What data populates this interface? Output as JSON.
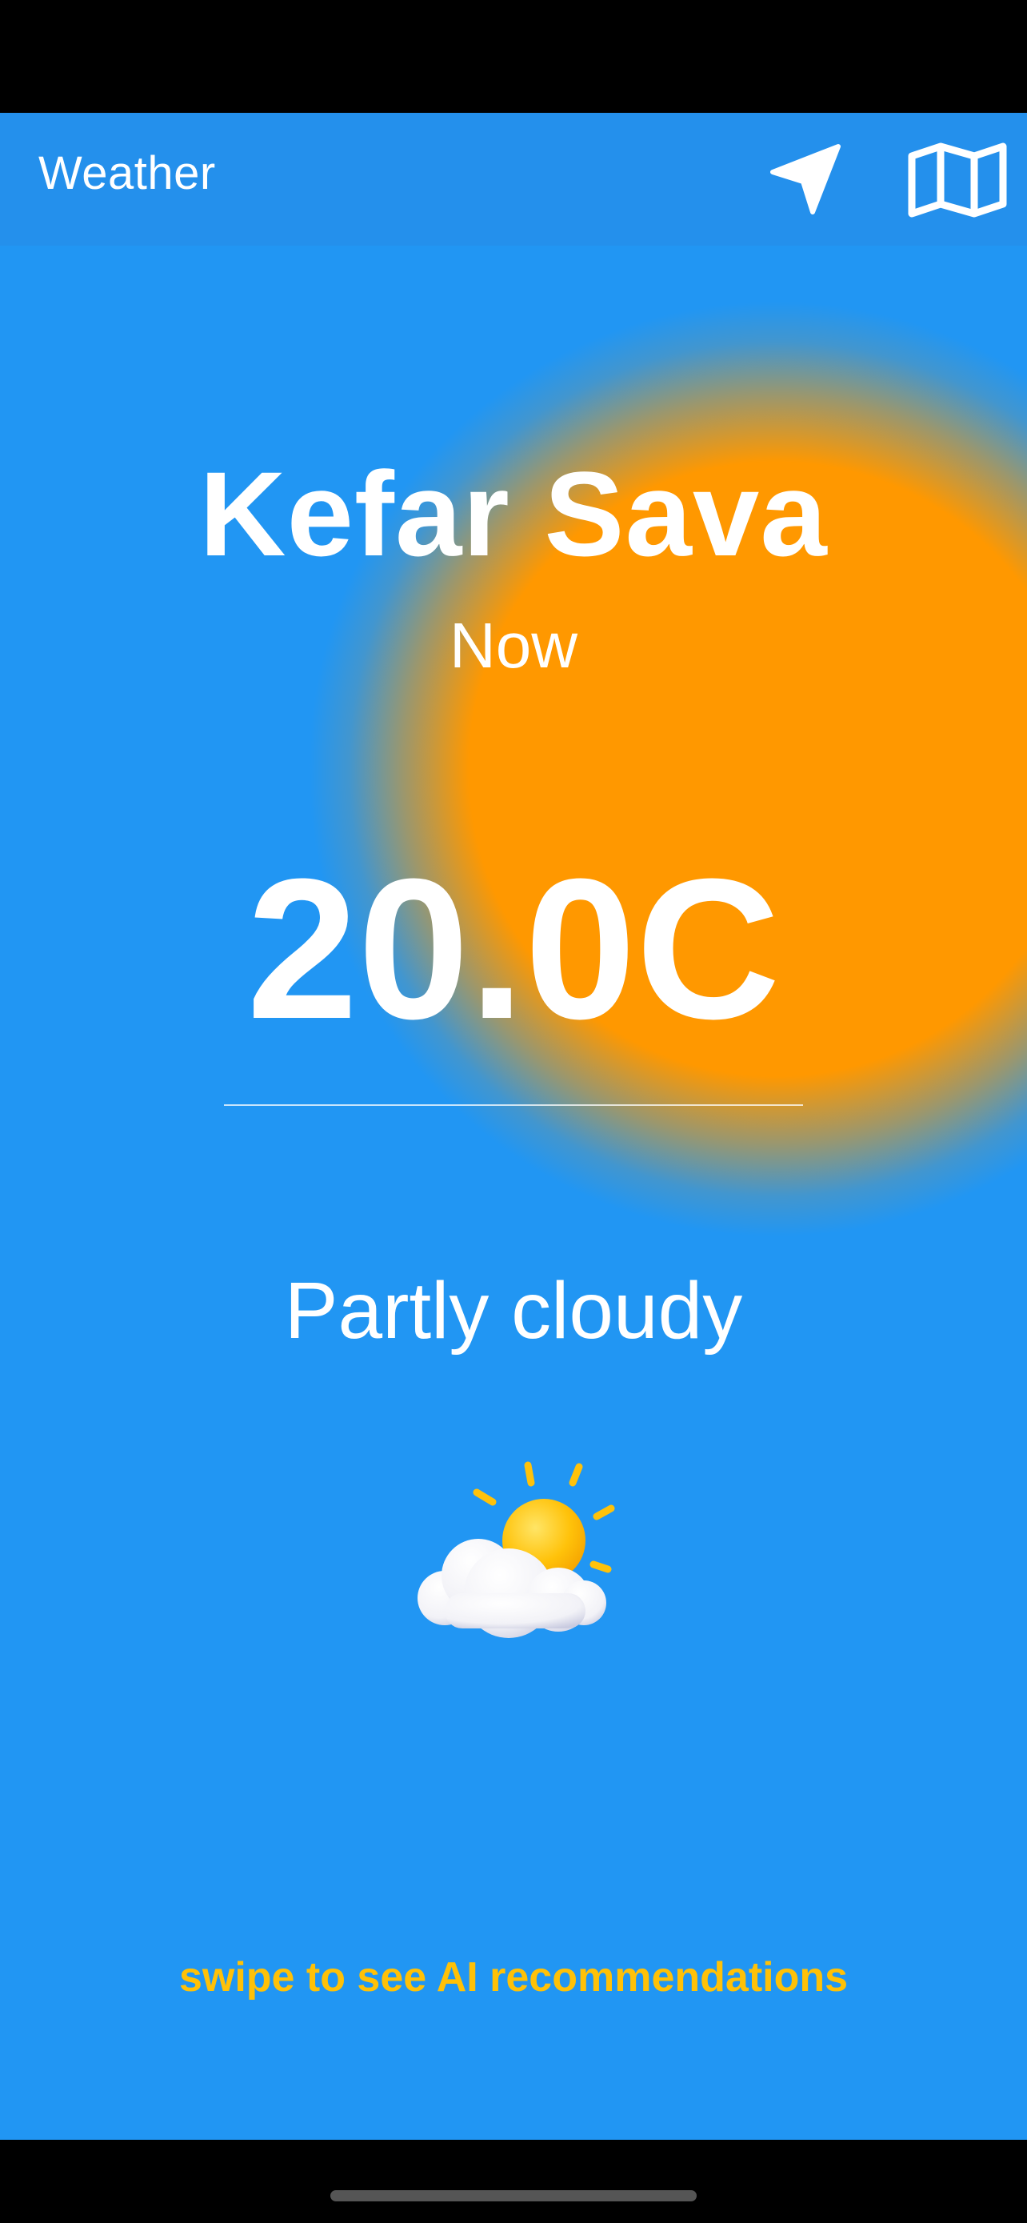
{
  "app_bar": {
    "title": "Weather",
    "icons": [
      "location-arrow-icon",
      "map-icon"
    ]
  },
  "weather": {
    "city": "Kefar Sava",
    "time_label": "Now",
    "temperature": "20.0C",
    "condition": "Partly cloudy",
    "condition_icon": "partly-cloudy-icon"
  },
  "footer": {
    "swipe_hint": "swipe to see AI recommendations"
  },
  "colors": {
    "background": "#2196F3",
    "sun_glow": "#FF9800",
    "accent_text": "#FFC107",
    "text": "#FFFFFF"
  }
}
